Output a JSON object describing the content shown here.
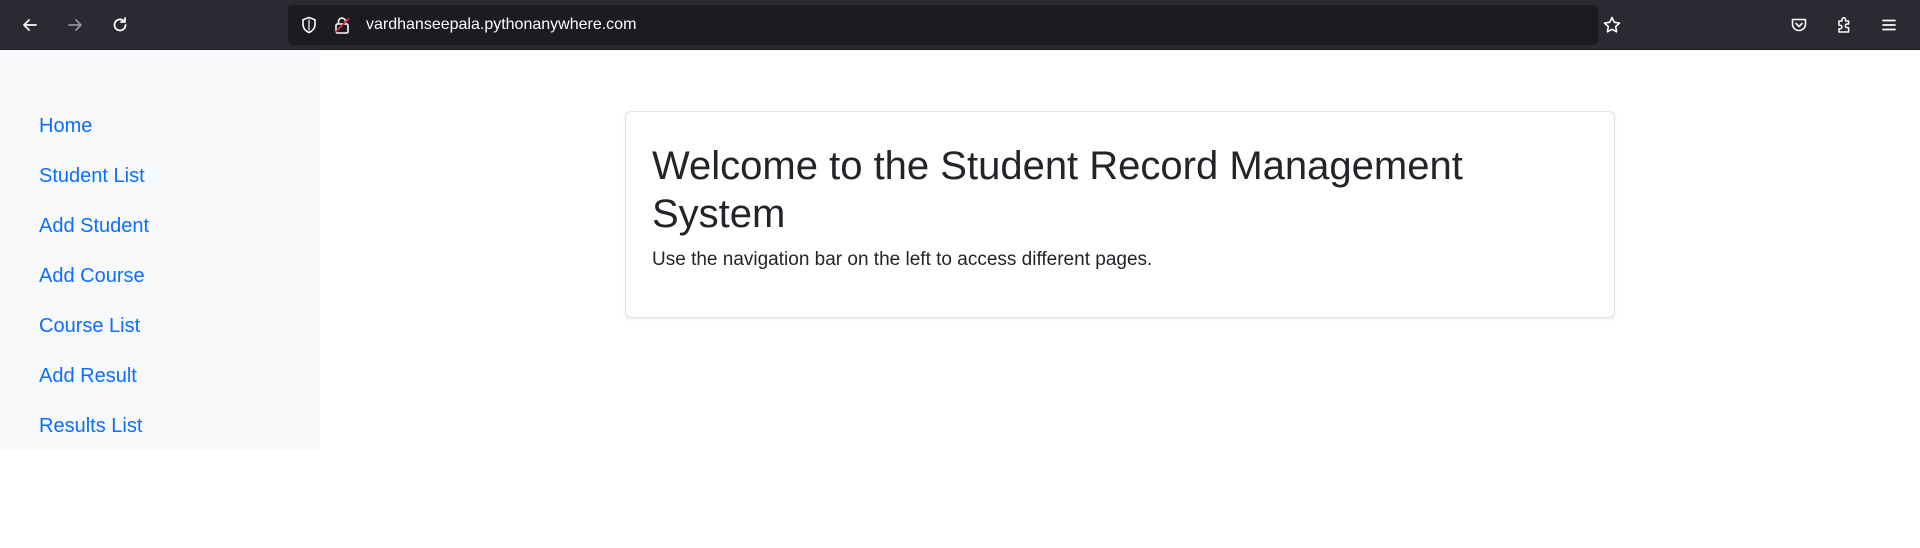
{
  "browser": {
    "url": "vardhanseepala.pythonanywhere.com",
    "icons": {
      "back": "back-arrow-icon",
      "forward": "forward-arrow-icon",
      "reload": "reload-icon",
      "shield": "tracking-protection-shield-icon",
      "lock": "insecure-lock-icon",
      "bookmark": "bookmark-star-icon",
      "pocket": "pocket-icon",
      "extensions": "extensions-puzzle-icon",
      "menu": "hamburger-menu-icon"
    }
  },
  "sidebar": {
    "items": [
      {
        "label": "Home"
      },
      {
        "label": "Student List"
      },
      {
        "label": "Add Student"
      },
      {
        "label": "Add Course"
      },
      {
        "label": "Course List"
      },
      {
        "label": "Add Result"
      },
      {
        "label": "Results List"
      }
    ]
  },
  "main": {
    "title": "Welcome to the Student Record Management System",
    "text": "Use the navigation bar on the left to access different pages."
  },
  "colors": {
    "toolbar_bg": "#2b2a33",
    "url_bar_bg": "#1c1b22",
    "sidebar_bg": "#f8f9fa",
    "link": "#0d6efd",
    "text": "#212529"
  }
}
